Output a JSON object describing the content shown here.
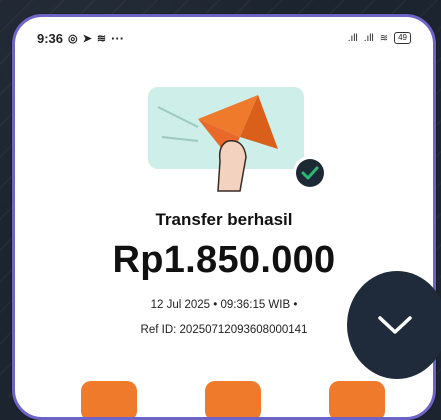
{
  "status_bar": {
    "time": "9:36",
    "notification_icons": [
      "whatsapp-icon",
      "telegram-icon",
      "app-icon"
    ],
    "overflow": "···",
    "battery": "49"
  },
  "transfer": {
    "title": "Transfer berhasil",
    "amount": "Rp1.850.000",
    "datetime": "12 Jul 2025 • 09:36:15 WIB •",
    "ref_id": "Ref ID: 20250712093608000141"
  },
  "colors": {
    "accent": "#f07a2c",
    "success": "#2bb673",
    "illustration_bg": "#cdeee9",
    "fab": "#1f2b3a",
    "frame": "#6e64c8"
  },
  "actions": [
    "action-button-1",
    "action-button-2",
    "action-button-3"
  ]
}
